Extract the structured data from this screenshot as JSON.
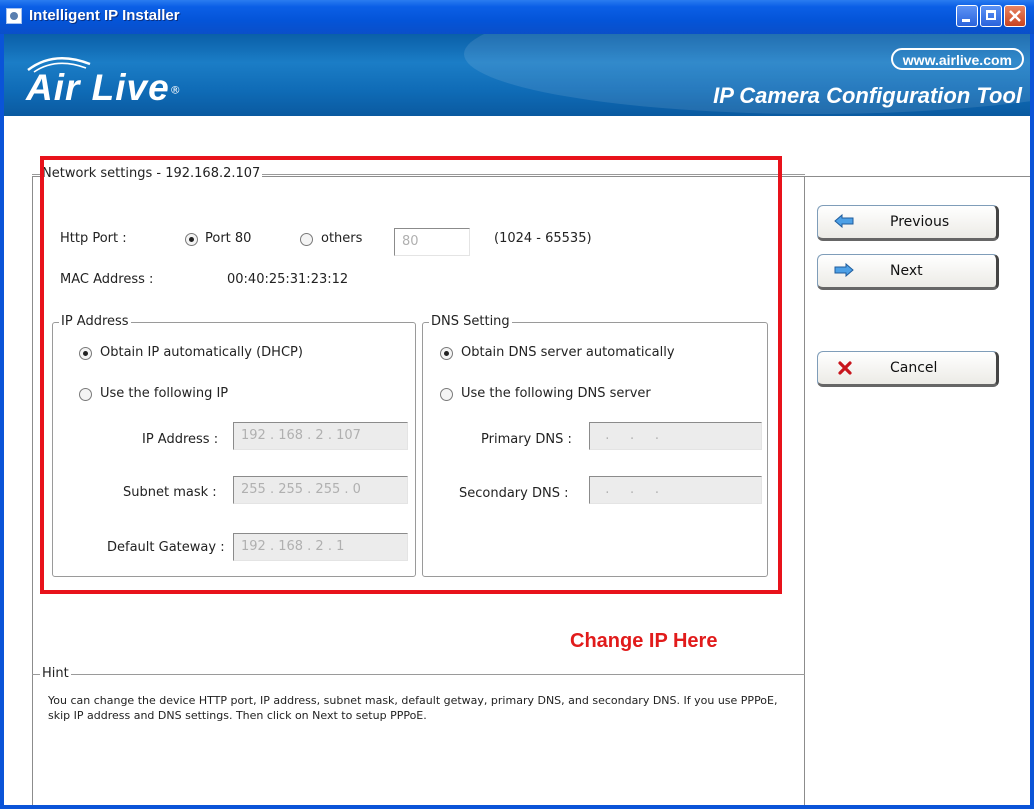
{
  "window": {
    "title": "Intelligent IP Installer",
    "controls": [
      "minimize-icon",
      "maximize-icon",
      "close-icon"
    ]
  },
  "banner": {
    "logo": "Air Live",
    "url": "www.airlive.com",
    "tool_title": "IP Camera Configuration Tool"
  },
  "network": {
    "group_title": "Network settings - 192.168.2.107",
    "http_port_label": "Http Port :",
    "port80_label": "Port 80",
    "others_label": "others",
    "port_value": "80",
    "port_range": "(1024 - 65535)",
    "mac_label": "MAC Address :",
    "mac_value": "00:40:25:31:23:12",
    "http_port_selected": "Port 80"
  },
  "ip": {
    "group_title": "IP Address",
    "dhcp_label": "Obtain IP automatically (DHCP)",
    "manual_label": "Use the following IP",
    "ip_label": "IP Address :",
    "ip_value": "192 . 168 .  2  . 107",
    "mask_label": "Subnet mask :",
    "mask_value": "255 . 255 . 255 .  0",
    "gateway_label": "Default Gateway :",
    "gateway_value": "192 . 168 .  2  .  1",
    "selected": "dhcp"
  },
  "dns": {
    "group_title": "DNS Setting",
    "auto_label": "Obtain DNS server automatically",
    "manual_label": "Use the following DNS server",
    "primary_label": "Primary DNS :",
    "primary_value": "  .     .     .  ",
    "secondary_label": "Secondary DNS :",
    "secondary_value": "  .     .     .  ",
    "selected": "auto"
  },
  "annotation": {
    "text": "Change IP Here",
    "color": "#e8121b"
  },
  "hint": {
    "title": "Hint",
    "text": "You can change the device HTTP port, IP address, subnet mask, default getway, primary DNS, and secondary DNS. If you use PPPoE, skip IP address and DNS settings. Then click on Next to setup PPPoE."
  },
  "buttons": {
    "previous": "Previous",
    "next": "Next",
    "cancel": "Cancel"
  },
  "colors": {
    "titlebar": "#0454d8",
    "banner": "#1b7dc6",
    "highlight": "#e8121b"
  }
}
